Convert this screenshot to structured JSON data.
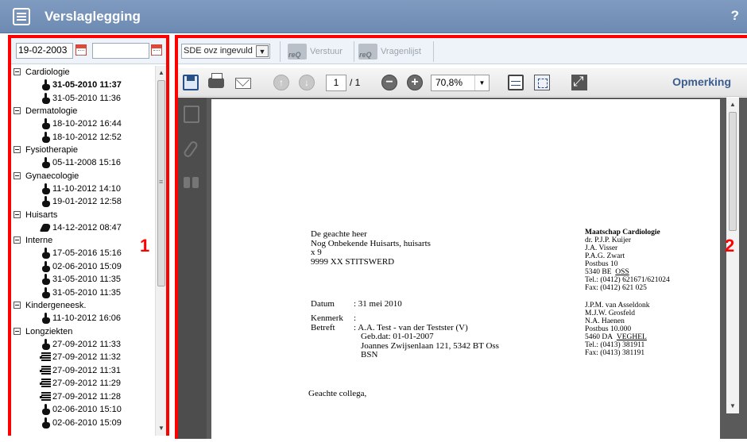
{
  "app": {
    "title": "Verslaglegging",
    "help": "?"
  },
  "dates": {
    "from": "19-02-2003",
    "to": ""
  },
  "tree": {
    "groups": [
      {
        "name": "Cardiologie",
        "items": [
          {
            "date": "31-05-2010 11:37",
            "icon": "hand-icon",
            "bold": true
          },
          {
            "date": "31-05-2010 11:36",
            "icon": "hand-icon"
          }
        ]
      },
      {
        "name": "Dermatologie",
        "items": [
          {
            "date": "18-10-2012 16:44",
            "icon": "hand-icon"
          },
          {
            "date": "18-10-2012 12:52",
            "icon": "hand-icon"
          }
        ]
      },
      {
        "name": "Fysiotherapie",
        "items": [
          {
            "date": "05-11-2008 15:16",
            "icon": "hand-icon"
          }
        ]
      },
      {
        "name": "Gynaecologie",
        "items": [
          {
            "date": "11-10-2012 14:10",
            "icon": "hand-icon"
          },
          {
            "date": "19-01-2012 12:58",
            "icon": "hand-icon"
          }
        ]
      },
      {
        "name": "Huisarts",
        "items": [
          {
            "date": "14-12-2012 08:47",
            "icon": "signature-icon"
          }
        ]
      },
      {
        "name": "Interne",
        "items": [
          {
            "date": "17-05-2016 15:16",
            "icon": "hand-icon"
          },
          {
            "date": "02-06-2010 15:09",
            "icon": "hand-icon"
          },
          {
            "date": "31-05-2010 11:35",
            "icon": "hand-icon"
          },
          {
            "date": "31-05-2010 11:35",
            "icon": "hand-icon"
          }
        ]
      },
      {
        "name": "Kindergeneesk.",
        "items": [
          {
            "date": "11-10-2012 16:06",
            "icon": "hand-icon"
          }
        ]
      },
      {
        "name": "Longziekten",
        "items": [
          {
            "date": "27-09-2012 11:33",
            "icon": "hand-icon"
          },
          {
            "date": "27-09-2012 11:32",
            "icon": "lines-icon"
          },
          {
            "date": "27-09-2012 11:31",
            "icon": "lines-icon"
          },
          {
            "date": "27-09-2012 11:29",
            "icon": "lines-icon"
          },
          {
            "date": "27-09-2012 11:28",
            "icon": "lines-icon"
          },
          {
            "date": "02-06-2010 15:10",
            "icon": "hand-icon"
          },
          {
            "date": "02-06-2010 15:09",
            "icon": "hand-icon"
          }
        ]
      }
    ]
  },
  "toolbar": {
    "status_select": "SDE ovz ingevuld",
    "send_label": "Verstuur",
    "questionnaire_label": "Vragenlijst"
  },
  "viewer": {
    "page_current": "1",
    "page_total": "/ 1",
    "zoom": "70,8%",
    "remark": "Opmerking"
  },
  "letter": {
    "addressee": [
      "De geachte heer",
      "Nog Onbekende Huisarts, huisarts",
      "x 9",
      "9999 XX  STITSWERD"
    ],
    "sender_firm": "Maatschap Cardiologie",
    "sender_block1": [
      "dr. P.J.P. Kuijer",
      "J.A. Visser",
      "P.A.G. Zwart",
      "Postbus 10"
    ],
    "sender_city1_zip": "5340 BE",
    "sender_city1": "OSS",
    "sender_phone1": "Tel.: (0412) 621671/621024",
    "sender_fax1": "Fax: (0412) 621 025",
    "sender_block2": [
      "J.P.M. van Asseldonk",
      "M.J.W. Grosfeld",
      "N.A. Haenen",
      "Postbus 10.000"
    ],
    "sender_city2_zip": "5460 DA",
    "sender_city2": "VEGHEL",
    "sender_phone2": "Tel.: (0413) 381911",
    "sender_fax2": "Fax: (0413) 381191",
    "date_label": "Datum",
    "date_value": ": 31 mei 2010",
    "ref_label": "Kenmerk",
    "ref_value": ":",
    "subject_label": "Betreft",
    "subject_value": ": A.A. Test - van der Testster (V)",
    "subject_lines": [
      "Geb.dat: 01-01-2007",
      "Joannes Zwijsenlaan 121, 5342 BT  Oss",
      "BSN"
    ],
    "greeting": "Geachte collega,"
  },
  "annotations": {
    "left_label": "1",
    "right_label": "2"
  }
}
